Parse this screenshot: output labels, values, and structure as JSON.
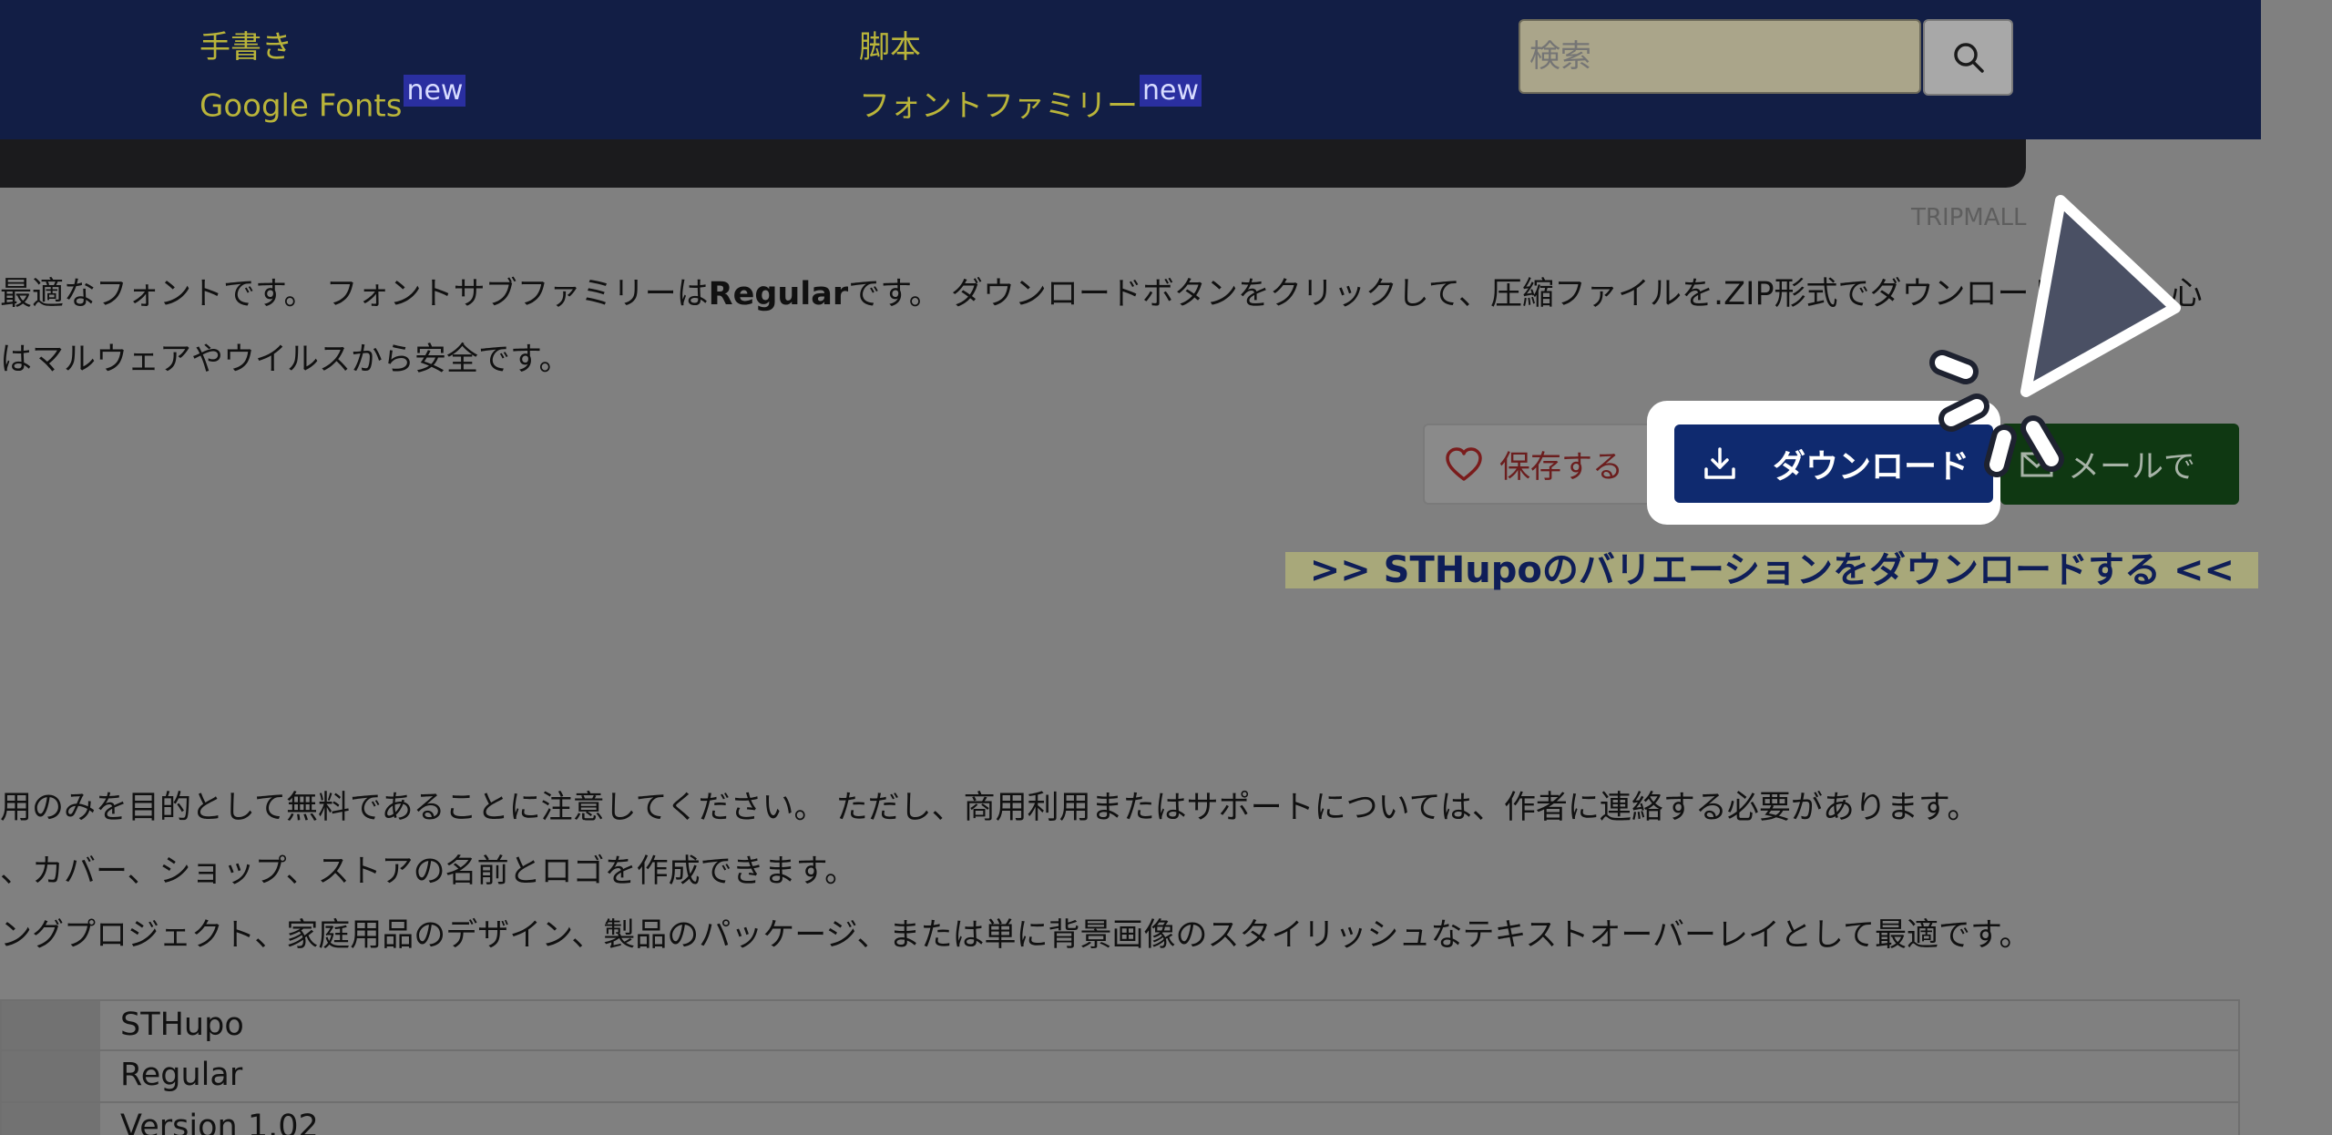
{
  "nav": {
    "col1": {
      "item1": "手書き",
      "item2": "Google Fonts",
      "item2_badge": "new"
    },
    "col2": {
      "item1": "脚本",
      "item2": "フォントファミリー",
      "item2_badge": "new"
    },
    "search": {
      "placeholder": "検索"
    }
  },
  "hero": {
    "credit": "TRIPMALL"
  },
  "description": {
    "line1_a": "最適なフォントです。 フォントサブファミリーは",
    "line1_bold": "Regular",
    "line1_b": "です。 ダウンロードボタンをクリックして、圧縮ファイルを.ZIP形式でダウンロード",
    "line1_tail": "心",
    "line2": "はマルウェアやウイルスから安全です。"
  },
  "actions": {
    "save_label": "保存する",
    "download_label": "ダウンロード",
    "mail_label": "メールで"
  },
  "variation_link": ">> STHupoのバリエーションをダウンロードする <<",
  "usage": {
    "line1": "用のみを目的として無料であることに注意してください。 ただし、商用利用またはサポートについては、作者に連絡する必要があります。",
    "line2": "、カバー、ショップ、ストアの名前とロゴを作成できます。",
    "line3": "ングプロジェクト、家庭用品のデザイン、製品のパッケージ、または単に背景画像のスタイリッシュなテキストオーバーレイとして最適です。"
  },
  "info_table": {
    "rows": [
      {
        "value": "STHupo"
      },
      {
        "value": "Regular"
      },
      {
        "value": "Version 1.02"
      }
    ]
  },
  "colors": {
    "nav_bg": "#121e45",
    "nav_link": "#b9b43a",
    "download_bg": "#0f2a6f",
    "mail_bg": "#0f3812",
    "save_heart": "#7a1c1c",
    "variation_highlight": "#a8a87a"
  }
}
